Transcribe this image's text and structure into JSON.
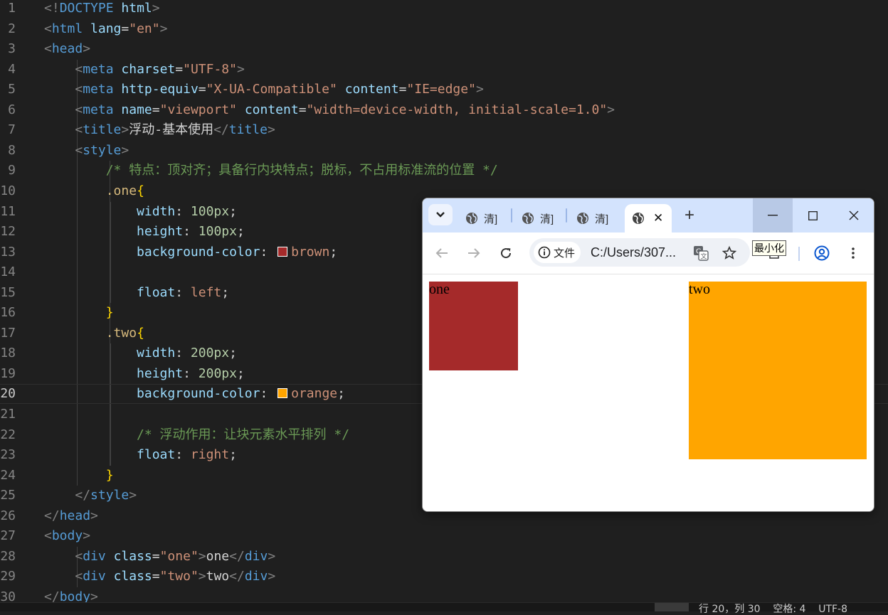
{
  "editor": {
    "gutter": [
      "1",
      "2",
      "3",
      "4",
      "5",
      "6",
      "7",
      "8",
      "9",
      "10",
      "11",
      "12",
      "13",
      "14",
      "15",
      "16",
      "17",
      "18",
      "19",
      "20",
      "21",
      "22",
      "23",
      "24",
      "25",
      "26",
      "27",
      "28",
      "29",
      "30"
    ],
    "active_line": "20",
    "colors": {
      "brown_swatch": "#a52a2a",
      "orange_swatch": "#ffa500"
    },
    "lines": [
      [
        [
          "t-br",
          "<!"
        ],
        [
          "t-tag",
          "DOCTYPE"
        ],
        [
          "t-text",
          " "
        ],
        [
          "t-attr",
          "html"
        ],
        [
          "t-br",
          ">"
        ]
      ],
      [
        [
          "t-br",
          "<"
        ],
        [
          "t-tag",
          "html"
        ],
        [
          "t-text",
          " "
        ],
        [
          "t-attr",
          "lang"
        ],
        [
          "t-text",
          "="
        ],
        [
          "t-str",
          "\"en\""
        ],
        [
          "t-br",
          ">"
        ]
      ],
      [
        [
          "t-br",
          "<"
        ],
        [
          "t-tag",
          "head"
        ],
        [
          "t-br",
          ">"
        ]
      ],
      [
        [
          "t-text",
          "    "
        ],
        [
          "t-br",
          "<"
        ],
        [
          "t-tag",
          "meta"
        ],
        [
          "t-text",
          " "
        ],
        [
          "t-attr",
          "charset"
        ],
        [
          "t-text",
          "="
        ],
        [
          "t-str",
          "\"UTF-8\""
        ],
        [
          "t-br",
          ">"
        ]
      ],
      [
        [
          "t-text",
          "    "
        ],
        [
          "t-br",
          "<"
        ],
        [
          "t-tag",
          "meta"
        ],
        [
          "t-text",
          " "
        ],
        [
          "t-attr",
          "http-equiv"
        ],
        [
          "t-text",
          "="
        ],
        [
          "t-str",
          "\"X-UA-Compatible\""
        ],
        [
          "t-text",
          " "
        ],
        [
          "t-attr",
          "content"
        ],
        [
          "t-text",
          "="
        ],
        [
          "t-str",
          "\"IE=edge\""
        ],
        [
          "t-br",
          ">"
        ]
      ],
      [
        [
          "t-text",
          "    "
        ],
        [
          "t-br",
          "<"
        ],
        [
          "t-tag",
          "meta"
        ],
        [
          "t-text",
          " "
        ],
        [
          "t-attr",
          "name"
        ],
        [
          "t-text",
          "="
        ],
        [
          "t-str",
          "\"viewport\""
        ],
        [
          "t-text",
          " "
        ],
        [
          "t-attr",
          "content"
        ],
        [
          "t-text",
          "="
        ],
        [
          "t-str",
          "\"width=device-width, initial-scale=1.0\""
        ],
        [
          "t-br",
          ">"
        ]
      ],
      [
        [
          "t-text",
          "    "
        ],
        [
          "t-br",
          "<"
        ],
        [
          "t-tag",
          "title"
        ],
        [
          "t-br",
          ">"
        ],
        [
          "t-text",
          "浮动-基本使用"
        ],
        [
          "t-br",
          "</"
        ],
        [
          "t-tag",
          "title"
        ],
        [
          "t-br",
          ">"
        ]
      ],
      [
        [
          "t-text",
          "    "
        ],
        [
          "t-br",
          "<"
        ],
        [
          "t-tag",
          "style"
        ],
        [
          "t-br",
          ">"
        ]
      ],
      [
        [
          "t-text",
          "        "
        ],
        [
          "t-cmt",
          "/* 特点：顶对齐；具备行内块特点；脱标，不占用标准流的位置 */"
        ]
      ],
      [
        [
          "t-text",
          "        "
        ],
        [
          "t-sel",
          ".one"
        ],
        [
          "t-brace",
          "{"
        ]
      ],
      [
        [
          "t-text",
          "            "
        ],
        [
          "t-prop",
          "width"
        ],
        [
          "t-text",
          ": "
        ],
        [
          "t-num",
          "100px"
        ],
        [
          "t-text",
          ";"
        ]
      ],
      [
        [
          "t-text",
          "            "
        ],
        [
          "t-prop",
          "height"
        ],
        [
          "t-text",
          ": "
        ],
        [
          "t-num",
          "100px"
        ],
        [
          "t-text",
          ";"
        ]
      ],
      [
        [
          "t-text",
          "            "
        ],
        [
          "t-prop",
          "background-color"
        ],
        [
          "t-text",
          ": "
        ],
        [
          "swatch",
          "brown_swatch"
        ],
        [
          "t-val",
          "brown"
        ],
        [
          "t-text",
          ";"
        ]
      ],
      [],
      [
        [
          "t-text",
          "            "
        ],
        [
          "t-prop",
          "float"
        ],
        [
          "t-text",
          ": "
        ],
        [
          "t-val",
          "left"
        ],
        [
          "t-text",
          ";"
        ]
      ],
      [
        [
          "t-text",
          "        "
        ],
        [
          "t-brace",
          "}"
        ]
      ],
      [
        [
          "t-text",
          "        "
        ],
        [
          "t-sel",
          ".two"
        ],
        [
          "t-brace",
          "{"
        ]
      ],
      [
        [
          "t-text",
          "            "
        ],
        [
          "t-prop",
          "width"
        ],
        [
          "t-text",
          ": "
        ],
        [
          "t-num",
          "200px"
        ],
        [
          "t-text",
          ";"
        ]
      ],
      [
        [
          "t-text",
          "            "
        ],
        [
          "t-prop",
          "height"
        ],
        [
          "t-text",
          ": "
        ],
        [
          "t-num",
          "200px"
        ],
        [
          "t-text",
          ";"
        ]
      ],
      [
        [
          "t-text",
          "            "
        ],
        [
          "t-prop",
          "background-color"
        ],
        [
          "t-text",
          ": "
        ],
        [
          "swatch",
          "orange_swatch"
        ],
        [
          "t-val",
          "orange"
        ],
        [
          "t-text",
          ";"
        ]
      ],
      [],
      [
        [
          "t-text",
          "            "
        ],
        [
          "t-cmt",
          "/* 浮动作用：让块元素水平排列 */"
        ]
      ],
      [
        [
          "t-text",
          "            "
        ],
        [
          "t-prop",
          "float"
        ],
        [
          "t-text",
          ": "
        ],
        [
          "t-val",
          "right"
        ],
        [
          "t-text",
          ";"
        ]
      ],
      [
        [
          "t-text",
          "        "
        ],
        [
          "t-brace",
          "}"
        ]
      ],
      [
        [
          "t-text",
          "    "
        ],
        [
          "t-br",
          "</"
        ],
        [
          "t-tag",
          "style"
        ],
        [
          "t-br",
          ">"
        ]
      ],
      [
        [
          "t-br",
          "</"
        ],
        [
          "t-tag",
          "head"
        ],
        [
          "t-br",
          ">"
        ]
      ],
      [
        [
          "t-br",
          "<"
        ],
        [
          "t-tag",
          "body"
        ],
        [
          "t-br",
          ">"
        ]
      ],
      [
        [
          "t-text",
          "    "
        ],
        [
          "t-br",
          "<"
        ],
        [
          "t-tag",
          "div"
        ],
        [
          "t-text",
          " "
        ],
        [
          "t-attr",
          "class"
        ],
        [
          "t-text",
          "="
        ],
        [
          "t-str",
          "\"one\""
        ],
        [
          "t-br",
          ">"
        ],
        [
          "t-text",
          "one"
        ],
        [
          "t-br",
          "</"
        ],
        [
          "t-tag",
          "div"
        ],
        [
          "t-br",
          ">"
        ]
      ],
      [
        [
          "t-text",
          "    "
        ],
        [
          "t-br",
          "<"
        ],
        [
          "t-tag",
          "div"
        ],
        [
          "t-text",
          " "
        ],
        [
          "t-attr",
          "class"
        ],
        [
          "t-text",
          "="
        ],
        [
          "t-str",
          "\"two\""
        ],
        [
          "t-br",
          ">"
        ],
        [
          "t-text",
          "two"
        ],
        [
          "t-br",
          "</"
        ],
        [
          "t-tag",
          "div"
        ],
        [
          "t-br",
          ">"
        ]
      ],
      [
        [
          "t-br",
          "</"
        ],
        [
          "t-tag",
          "body"
        ],
        [
          "t-br",
          ">"
        ]
      ]
    ]
  },
  "statusbar": {
    "text": "行 20，列 30    空格: 4    UTF-8"
  },
  "browser": {
    "tabs": [
      {
        "label": "清]"
      },
      {
        "label": "清]"
      },
      {
        "label": "清]"
      }
    ],
    "active_tab_close": "✕",
    "new_tab": "+",
    "window_buttons": {
      "minimize": "—",
      "maximize": "☐",
      "close": "✕"
    },
    "info_chip": "文件",
    "url": "C:/Users/307...",
    "tooltip": "最小化",
    "page": {
      "one": {
        "text": "one",
        "color": "#a52a2a"
      },
      "two": {
        "text": "two",
        "color": "#ffa500"
      }
    },
    "colors": {
      "tabstrip": "#d3e3fd",
      "accent": "#0b57d0"
    }
  }
}
